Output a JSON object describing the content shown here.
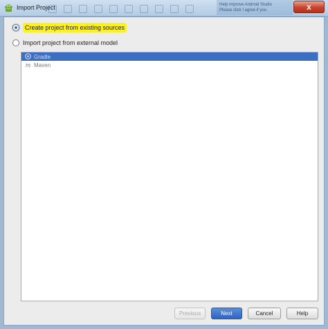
{
  "window": {
    "title": "Import Project",
    "close_label": "x"
  },
  "background_notice": {
    "line1": "Help improve Android Studio",
    "line2": "Please click I agree if you"
  },
  "options": [
    {
      "label": "Create project from existing sources",
      "checked": true,
      "highlight_color": "#fff21a"
    },
    {
      "label": "Import project from external model",
      "checked": false
    }
  ],
  "model_list": {
    "items": [
      {
        "label": "Gradle",
        "icon": "gradle-icon",
        "selected": true
      },
      {
        "label": "Maven",
        "icon": "maven-icon",
        "glyph": "m",
        "selected": false
      }
    ],
    "selection_color": "#3b6fc4"
  },
  "buttons": {
    "previous": "Previous",
    "next": "Next",
    "cancel": "Cancel",
    "help": "Help"
  }
}
